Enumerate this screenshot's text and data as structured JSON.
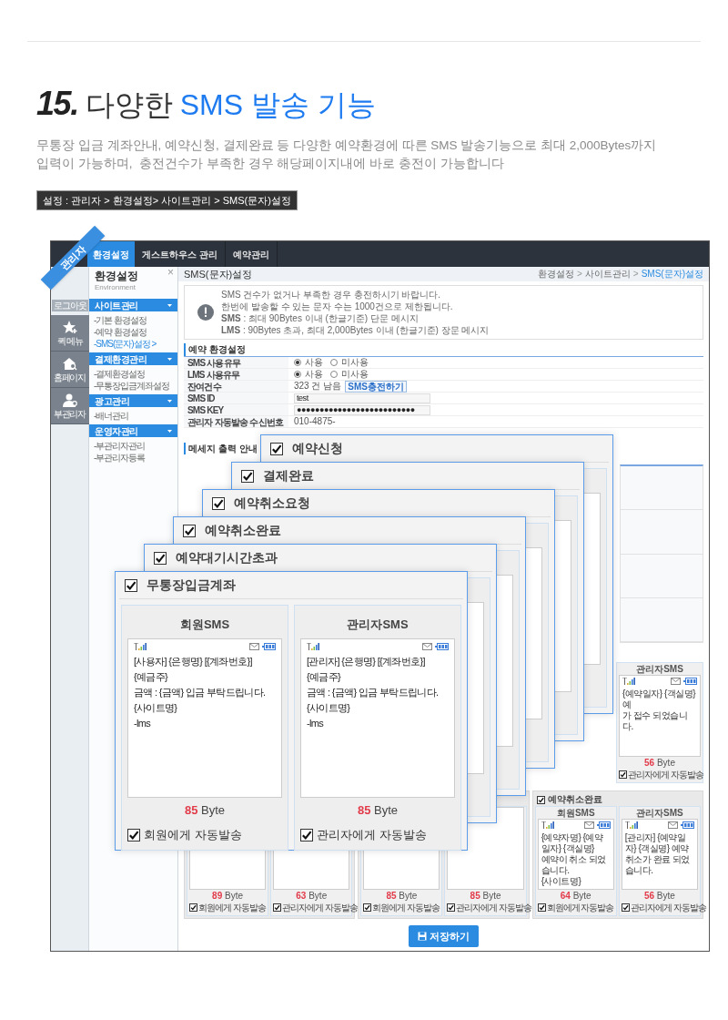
{
  "heading": {
    "number": "15.",
    "lead": "다양한",
    "highlight": "SMS 발송 기능"
  },
  "description": [
    "무통장 입금 계좌안내, 예약신청, 결제완료 등 다양한 예약환경에 따른 SMS 발송기능으로 최대 2,000Bytes까지",
    "입력이 가능하며,  충전건수가 부족한 경우 해당페이지내에 바로 충전이 가능합니다"
  ],
  "path_badge": "설정 : 관리자 > 환경설정> 사이트관리 > SMS(문자)설정",
  "admin": {
    "ribbon": "관리자",
    "tabs": [
      {
        "label": "환경설정",
        "selected": true
      },
      {
        "label": "게스트하우스 관리",
        "selected": false
      },
      {
        "label": "예약관리",
        "selected": false
      }
    ],
    "rail": {
      "logout": "로그아웃",
      "items": [
        {
          "kind": "star",
          "label": "퀵 메뉴"
        },
        {
          "kind": "home",
          "label": "홈페이지"
        },
        {
          "kind": "user",
          "label": "부관리자"
        }
      ]
    },
    "sidebar": {
      "title": "환경설정",
      "subtitle": "Environment",
      "close": "×",
      "sections": [
        {
          "title": "사이트관리",
          "items": [
            {
              "label": "-기본 환경설정",
              "selected": false
            },
            {
              "label": "-예약 환경설정",
              "selected": false
            },
            {
              "label": "-SMS(문자)설정 >",
              "selected": true
            }
          ]
        },
        {
          "title": "결제환경관리",
          "items": [
            {
              "label": "-결제환경설정",
              "selected": false
            },
            {
              "label": "-무통장입금계좌설정",
              "selected": false
            }
          ]
        },
        {
          "title": "광고관리",
          "items": [
            {
              "label": "-배너관리",
              "selected": false
            }
          ]
        },
        {
          "title": "운영자관리",
          "items": [
            {
              "label": "-부관리자관리",
              "selected": false
            },
            {
              "label": "-부관리자등록",
              "selected": false
            }
          ]
        }
      ]
    },
    "page_title": "SMS(문자)설정",
    "breadcrumb": {
      "separator": ">",
      "items": [
        {
          "label": "환경설정",
          "current": false
        },
        {
          "label": "사이트관리",
          "current": false
        },
        {
          "label": "SMS(문자)설정",
          "current": true
        }
      ]
    },
    "notice": [
      "SMS 건수가 없거나 부족한 경우 충전하시기 바랍니다.",
      "한번에 발송할 수 있는 문자 수는 1000건으로 제한됩니다.",
      "**SMS** : 최대 90Bytes 이내 (한글기준) 단문 메시지",
      "**LMS** : 90Bytes 초과, 최대 2,000Bytes 이내 (한글기준) 장문 메시지"
    ],
    "settings": {
      "title": "예약 환경설정",
      "rows": [
        {
          "label": "SMS 사용유무",
          "kind": "radio",
          "options": [
            {
              "label": "사용",
              "selected": true
            },
            {
              "label": "미사용",
              "selected": false
            }
          ]
        },
        {
          "label": "LMS 사용유무",
          "kind": "radio",
          "options": [
            {
              "label": "사용",
              "selected": true
            },
            {
              "label": "미사용",
              "selected": false
            }
          ]
        },
        {
          "label": "잔여건수",
          "kind": "count",
          "value": "323 건 남음",
          "button": "SMS충전하기"
        },
        {
          "label": "SMS ID",
          "kind": "input",
          "value": "test"
        },
        {
          "label": "SMS KEY",
          "kind": "input",
          "value": "●●●●●●●●●●●●●●●●●●●●●●●●●●"
        },
        {
          "label": "관리자 자동발송 수신번호",
          "kind": "text",
          "value": "010-4875-"
        }
      ]
    },
    "guide_title": "메세지 출력 안내",
    "upper_cards": [
      {
        "title": "관리자SMS",
        "lines": [
          "{예약일자} {객실명} 예",
          "가 접수 되었습니다."
        ],
        "bytes": "56",
        "unit": "Byte",
        "auto_send": {
          "label": "관리자에게 자동발송",
          "checked": true
        }
      }
    ],
    "lower_groups": [
      {
        "cards": [
          {
            "bytes": "89",
            "unit": "Byte",
            "auto_send": {
              "label": "회원에게 자동발송",
              "checked": true
            }
          },
          {
            "bytes": "63",
            "unit": "Byte",
            "auto_send": {
              "label": "관리자에게 자동발송",
              "checked": true
            }
          }
        ]
      },
      {
        "cards": [
          {
            "bytes": "85",
            "unit": "Byte",
            "auto_send": {
              "label": "회원에게 자동발송",
              "checked": true
            }
          },
          {
            "bytes": "85",
            "unit": "Byte",
            "auto_send": {
              "label": "관리자에게 자동발송",
              "checked": true
            }
          }
        ]
      },
      {
        "title": "예약취소완료",
        "checked": true,
        "cards": [
          {
            "title": "회원SMS",
            "lines": [
              "{예약자명} {예약일자} {객실명}",
              "예약이 취소 되었습니다.",
              "{사이트명}"
            ],
            "bytes": "64",
            "unit": "Byte",
            "auto_send": {
              "label": "회원에게 자동발송",
              "checked": true
            }
          },
          {
            "title": "관리자SMS",
            "lines": [
              "[관리자] {예약일자} {객실명} 예약취소가 완료 되었습니다."
            ],
            "bytes": "56",
            "unit": "Byte",
            "auto_send": {
              "label": "관리자에게 자동발송",
              "checked": true
            }
          }
        ]
      }
    ],
    "save_button": "저장하기"
  },
  "event_panels": [
    {
      "title": "예약신청",
      "checked": true
    },
    {
      "title": "결제완료",
      "checked": true
    },
    {
      "title": "예약취소요청",
      "checked": true
    },
    {
      "title": "예약취소완료",
      "checked": true
    },
    {
      "title": "예약대기시간초과",
      "checked": true
    },
    {
      "title": "무통장입금계좌",
      "checked": true,
      "cards": [
        {
          "title": "회원SMS",
          "lines": [
            "[사용자] {은행명} [{계좌번호}]",
            "{예금주}",
            "금액 : {금액} 입금 부탁드립니다.",
            "{사이트명}",
            "-lms"
          ],
          "bytes": "85",
          "unit": "Byte",
          "auto_send": {
            "label": "회원에게 자동발송",
            "checked": true
          }
        },
        {
          "title": "관리자SMS",
          "lines": [
            "[관리자] {은행명} [{계좌번호}]",
            "{예금주}",
            "금액 : {금액} 입금 부탁드립니다.",
            "{사이트명}",
            "-lms"
          ],
          "bytes": "85",
          "unit": "Byte",
          "auto_send": {
            "label": "관리자에게 자동발송",
            "checked": true
          }
        }
      ]
    }
  ]
}
